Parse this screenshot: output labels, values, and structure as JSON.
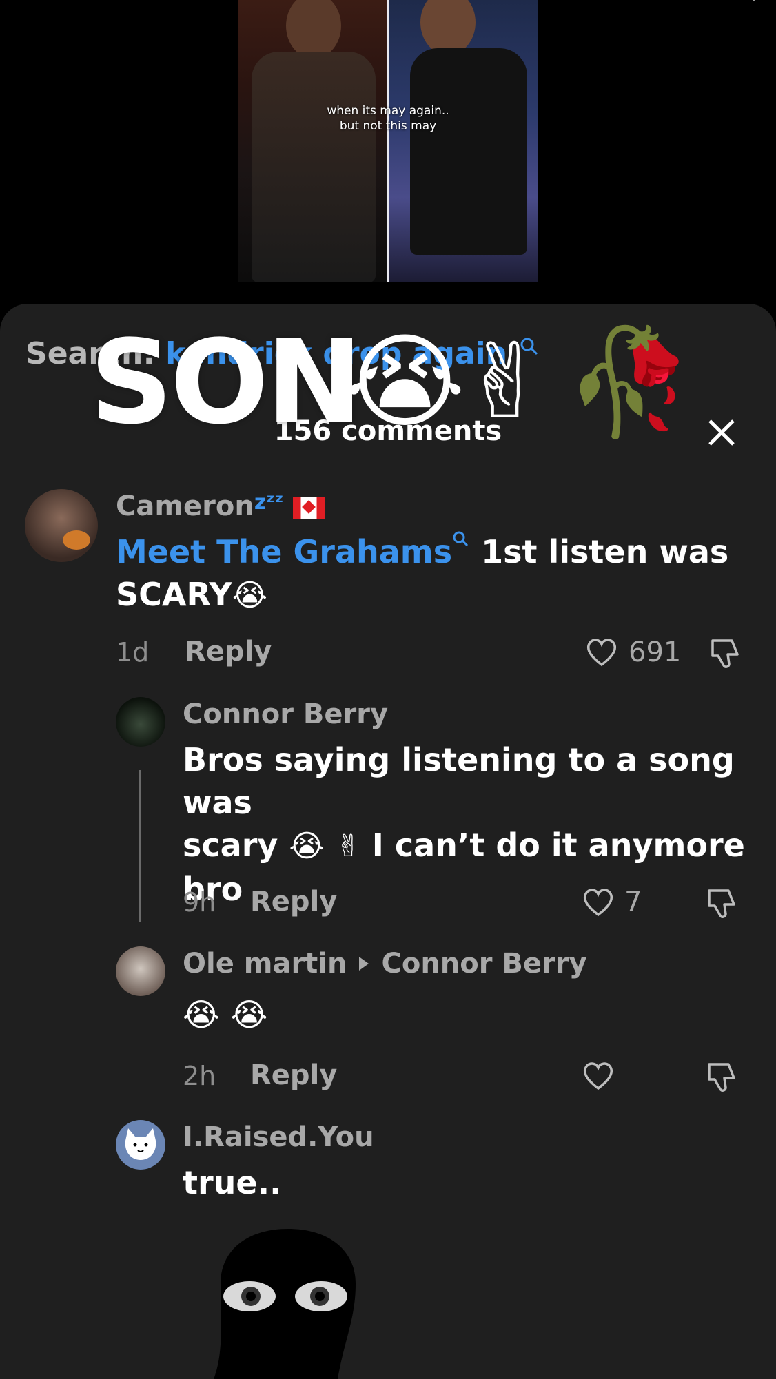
{
  "video": {
    "caption_line1": "when its may again..",
    "caption_line2": "but not this may"
  },
  "search": {
    "prefix": "Search: ",
    "query": "kendrick drop again",
    "icon": "search-icon"
  },
  "comments_header": {
    "count_label": "156 comments",
    "close_icon": "close-icon"
  },
  "overlay": {
    "text": "SON",
    "emojis": [
      "😭",
      "✌",
      "🥀"
    ]
  },
  "comments": [
    {
      "username": "Cameron",
      "username_suffix": "zᶻᶻ",
      "flag": "🇨🇦",
      "hashtag": "Meet The Grahams",
      "text_line1": " 1st listen was",
      "text_line2": "SCARY",
      "emoji": "😭",
      "time": "1d",
      "reply_label": "Reply",
      "likes": "691"
    },
    {
      "username": "Connor Berry",
      "text_line1": "Bros saying listening to a song was",
      "text_line2_a": "scary ",
      "emoji_a": "😭",
      "emoji_b": "✌",
      "text_line2_b": " I can’t do it anymore",
      "text_line3": "bro",
      "time": "9h",
      "reply_label": "Reply",
      "likes": "7"
    },
    {
      "username": "Ole martin",
      "reply_to": "Connor Berry",
      "text": "😭 😭",
      "time": "2h",
      "reply_label": "Reply",
      "likes": ""
    },
    {
      "username": "I.Raised.You",
      "text": "true.."
    }
  ],
  "colors": {
    "sheet_bg": "#1f1f1f",
    "hashtag_blue": "#3b92ec",
    "muted": "#a8a8a8"
  }
}
